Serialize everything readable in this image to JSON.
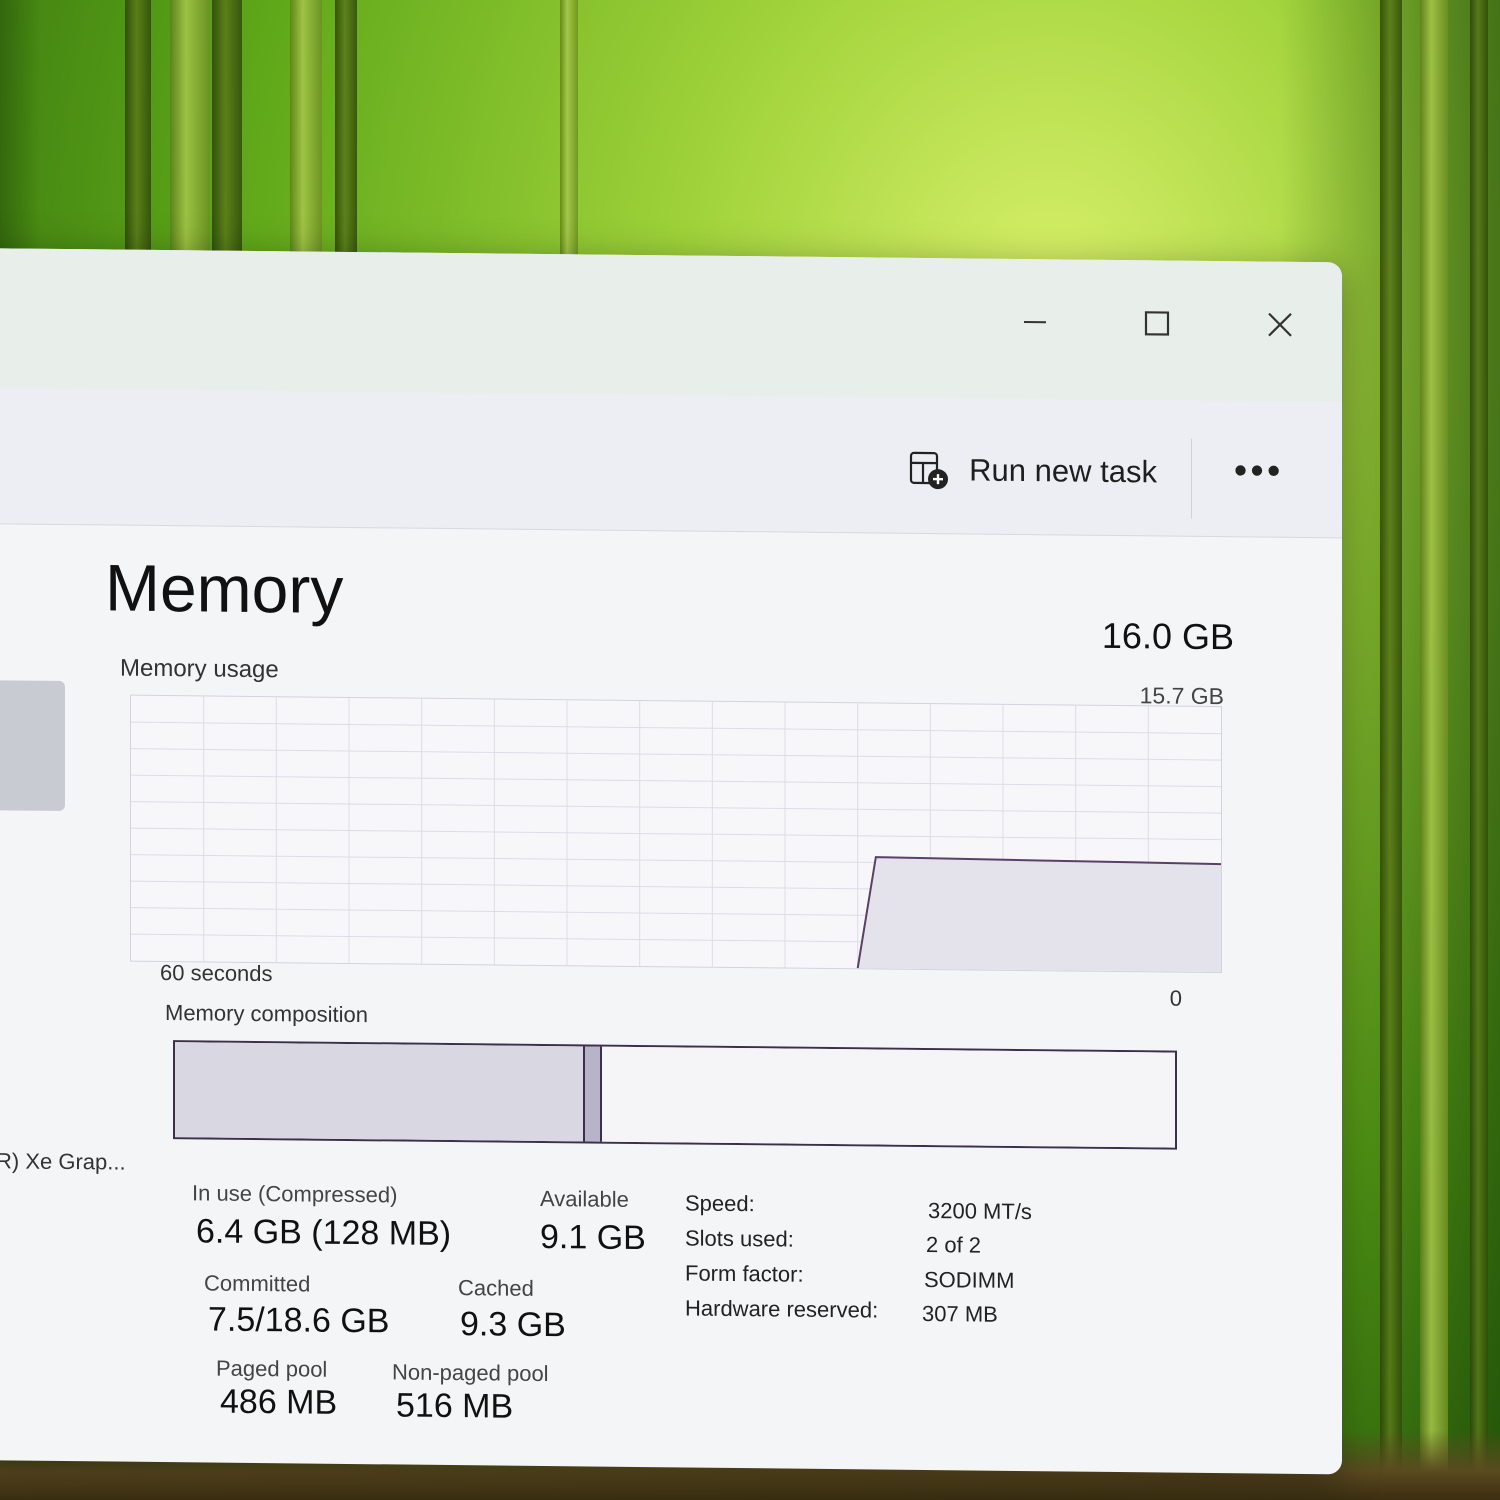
{
  "window": {
    "controls": {
      "minimize_icon": "minimize-icon",
      "maximize_icon": "maximize-icon",
      "close_icon": "close-icon"
    }
  },
  "commandbar": {
    "run_new_task": "Run new task",
    "more_label": "•••"
  },
  "sidebar": {
    "partial_item": "R) Xe Grap..."
  },
  "memory": {
    "title": "Memory",
    "total": "16.0 GB",
    "usage_label": "Memory usage",
    "usage_max": "15.7 GB",
    "axis_left": "60 seconds",
    "axis_right": "0",
    "composition_label": "Memory composition",
    "stats": {
      "in_use_label": "In use (Compressed)",
      "in_use_value": "6.4 GB (128 MB)",
      "available_label": "Available",
      "available_value": "9.1 GB",
      "committed_label": "Committed",
      "committed_value": "7.5/18.6 GB",
      "cached_label": "Cached",
      "cached_value": "9.3 GB",
      "paged_pool_label": "Paged pool",
      "paged_pool_value": "486 MB",
      "non_paged_pool_label": "Non-paged pool",
      "non_paged_pool_value": "516 MB"
    },
    "specs": {
      "speed_label": "Speed:",
      "speed_value": "3200 MT/s",
      "slots_label": "Slots used:",
      "slots_value": "2 of 2",
      "form_factor_label": "Form factor:",
      "form_factor_value": "SODIMM",
      "hw_reserved_label": "Hardware reserved:",
      "hw_reserved_value": "307 MB"
    }
  },
  "chart_data": {
    "type": "area",
    "title": "Memory usage",
    "xlabel": "",
    "ylabel": "",
    "x_range_seconds": [
      60,
      0
    ],
    "ylim": [
      0,
      15.7
    ],
    "grid": true,
    "series": [
      {
        "x": [
          60,
          20,
          19,
          10,
          0
        ],
        "values": [
          0,
          0,
          6.6,
          6.5,
          6.4
        ]
      }
    ]
  },
  "composition": [
    {
      "segment": "in-use",
      "fraction": 0.41,
      "color": "#d9d7e2"
    },
    {
      "segment": "modified",
      "fraction": 0.015,
      "color": "#b8b3c9"
    },
    {
      "segment": "standby-free",
      "fraction": 0.575,
      "color": "#f5f5f8"
    }
  ],
  "colors": {
    "accent": "#3b2f4a",
    "line": "#5a3f66"
  }
}
